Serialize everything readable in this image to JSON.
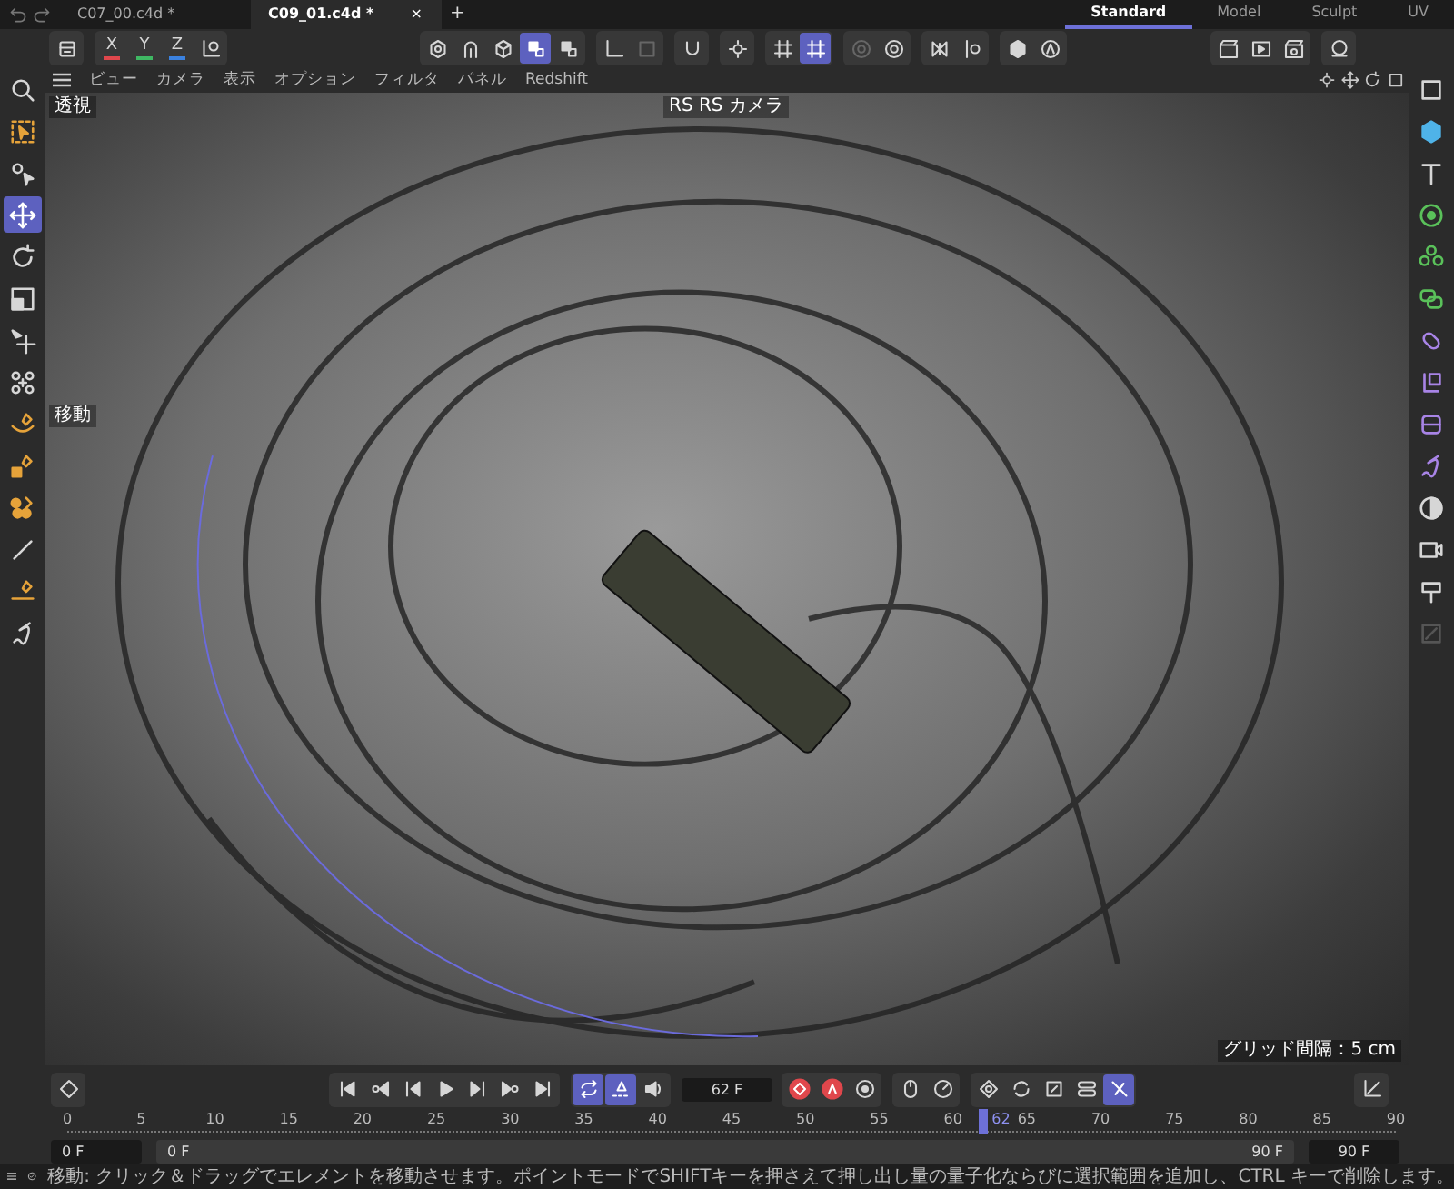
{
  "file_tabs": [
    {
      "label": "C07_00.c4d *",
      "selected": false
    },
    {
      "label": "C09_01.c4d *",
      "selected": true
    }
  ],
  "close_tab": "×",
  "new_tab": "+",
  "layouts": [
    {
      "label": "Standard",
      "selected": true
    },
    {
      "label": "Model",
      "selected": false
    },
    {
      "label": "Sculpt",
      "selected": false
    },
    {
      "label": "UV",
      "selected": false
    }
  ],
  "toolbar": {
    "groups": [
      [
        {
          "kind": "icon",
          "selected": false
        }
      ],
      [
        {
          "kind": "axis",
          "label": "X",
          "color": "#e0474c",
          "selected": true
        },
        {
          "kind": "axis",
          "label": "Y",
          "color": "#3fb863",
          "selected": true
        },
        {
          "kind": "axis",
          "label": "Z",
          "color": "#3b82e0",
          "selected": true
        },
        {
          "kind": "icon",
          "selected": false
        }
      ],
      [
        {
          "kind": "icon",
          "selected": false
        },
        {
          "kind": "icon",
          "selected": false
        },
        {
          "kind": "icon",
          "selected": false
        },
        {
          "kind": "icon",
          "selected": true
        },
        {
          "kind": "icon",
          "selected": false
        }
      ],
      [
        {
          "kind": "icon",
          "selected": false
        },
        {
          "kind": "icon",
          "selected": false
        }
      ],
      [
        {
          "kind": "icon",
          "selected": false
        }
      ],
      [
        {
          "kind": "icon",
          "selected": false
        }
      ],
      [
        {
          "kind": "icon",
          "selected": false
        },
        {
          "kind": "icon",
          "selected": true
        }
      ],
      [
        {
          "kind": "icon",
          "selected": false
        },
        {
          "kind": "icon",
          "selected": false
        }
      ],
      [
        {
          "kind": "icon",
          "selected": false
        },
        {
          "kind": "icon",
          "selected": false
        }
      ],
      [
        {
          "kind": "icon",
          "selected": false
        },
        {
          "kind": "icon",
          "selected": false
        }
      ]
    ],
    "render_groups": [
      [
        {
          "selected": false
        },
        {
          "selected": false
        },
        {
          "selected": false
        }
      ],
      [
        {
          "selected": false
        }
      ]
    ]
  },
  "view_menu": [
    "ビュー",
    "カメラ",
    "表示",
    "オプション",
    "フィルタ",
    "パネル",
    "Redshift"
  ],
  "viewport": {
    "projection": "透視",
    "camera": "RS RS カメラ",
    "tool_name": "移動",
    "grid_spacing": "グリッド間隔：5 cm"
  },
  "left_tools": [
    {
      "selected": false
    },
    {
      "selected": false
    },
    {
      "selected": false
    },
    {
      "selected": true
    },
    {
      "selected": false
    },
    {
      "selected": false
    },
    {
      "selected": false
    },
    {
      "selected": false
    },
    {
      "selected": false
    },
    {
      "selected": false
    },
    {
      "selected": false
    },
    {
      "selected": false
    },
    {
      "selected": false
    },
    {
      "selected": false
    }
  ],
  "right_tools": [
    {
      "selected": false
    },
    {
      "selected": false
    },
    {
      "selected": false
    },
    {
      "selected": false
    },
    {
      "selected": false
    },
    {
      "selected": false
    },
    {
      "selected": false
    },
    {
      "selected": false
    },
    {
      "selected": false
    },
    {
      "selected": false
    },
    {
      "selected": false
    },
    {
      "selected": false
    },
    {
      "selected": false
    },
    {
      "selected": false
    }
  ],
  "timeline": {
    "current_frame": "62 F",
    "transport": [
      {
        "selected": false
      },
      {
        "selected": false
      },
      {
        "selected": false
      },
      {
        "selected": false
      },
      {
        "selected": false
      },
      {
        "selected": false
      },
      {
        "selected": false
      }
    ],
    "playback": [
      {
        "selected": true
      },
      {
        "selected": true
      },
      {
        "selected": false
      }
    ],
    "record": [
      {
        "selected": false
      },
      {
        "selected": false
      },
      {
        "selected": false
      }
    ],
    "motion": [
      {
        "selected": false
      },
      {
        "selected": false
      }
    ],
    "keys": [
      {
        "selected": false
      },
      {
        "selected": false
      },
      {
        "selected": false
      },
      {
        "selected": false
      },
      {
        "selected": true
      }
    ],
    "ruler_labels": [
      "0",
      "5",
      "10",
      "15",
      "20",
      "25",
      "30",
      "35",
      "40",
      "45",
      "50",
      "55",
      "60",
      "65",
      "70",
      "75",
      "80",
      "85",
      "90"
    ],
    "playhead": {
      "label": "62",
      "level": 0.689
    },
    "start_fields": [
      "0 F",
      "0 F"
    ],
    "end_fields": [
      "90 F",
      "90 F"
    ]
  },
  "status_bar": "移動: クリック＆ドラッグでエレメントを移動させます。ポイントモードでSHIFTキーを押さえて押し出し量の量子化ならびに選択範囲を追加し、CTRL キーで削除します。"
}
